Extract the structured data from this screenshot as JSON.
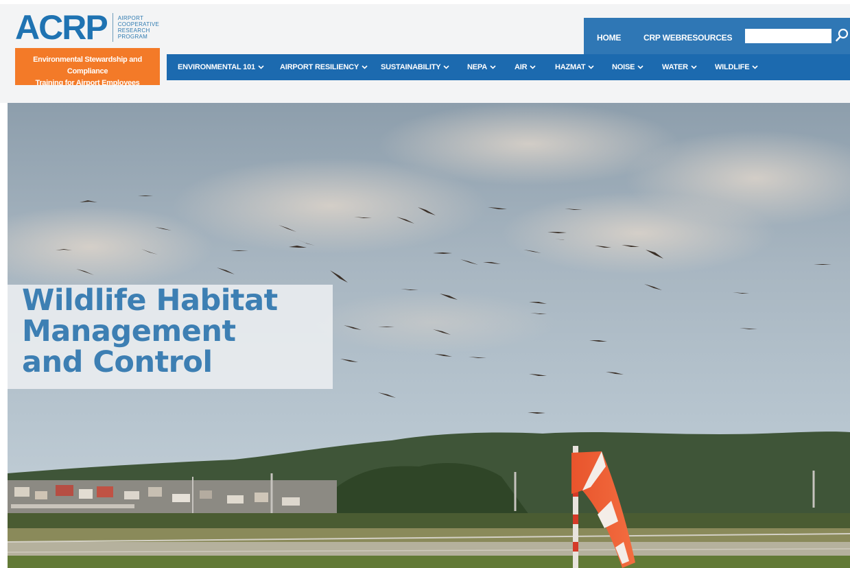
{
  "logo": {
    "wordmark": "ACRP",
    "subtitle_lines": [
      "AIRPORT",
      "COOPERATIVE",
      "RESEARCH",
      "PROGRAM"
    ]
  },
  "program_box": {
    "lines": [
      "Environmental Stewardship and Compliance",
      "Training for Airport Employees"
    ]
  },
  "top_links": [
    {
      "label": "HOME"
    },
    {
      "label": "CRP WEBRESOURCES"
    }
  ],
  "search": {
    "value": "",
    "placeholder": "",
    "icon": "search-icon"
  },
  "nav": [
    {
      "label": "ENVIRONMENTAL 101",
      "icon": "chevron-down-icon"
    },
    {
      "label": "AIRPORT RESILIENCY",
      "icon": "chevron-down-icon"
    },
    {
      "label": "SUSTAINABILITY",
      "icon": "chevron-down-icon"
    },
    {
      "label": "NEPA",
      "icon": "chevron-down-icon"
    },
    {
      "label": "AIR",
      "icon": "chevron-down-icon"
    },
    {
      "label": "HAZMAT",
      "icon": "chevron-down-icon"
    },
    {
      "label": "NOISE",
      "icon": "chevron-down-icon"
    },
    {
      "label": "WATER",
      "icon": "chevron-down-icon"
    },
    {
      "label": "WILDLIFE",
      "icon": "chevron-down-icon"
    }
  ],
  "hero": {
    "title_lines": [
      "Wildlife Habitat",
      "Management",
      "and Control"
    ],
    "image_alt_icon": "birds-over-airfield-photo"
  },
  "colors": {
    "brand_blue": "#1c6aaf",
    "top_bar_blue": "#2f77b5",
    "orange": "#f37a28",
    "title_blue": "#3d7fb3"
  }
}
